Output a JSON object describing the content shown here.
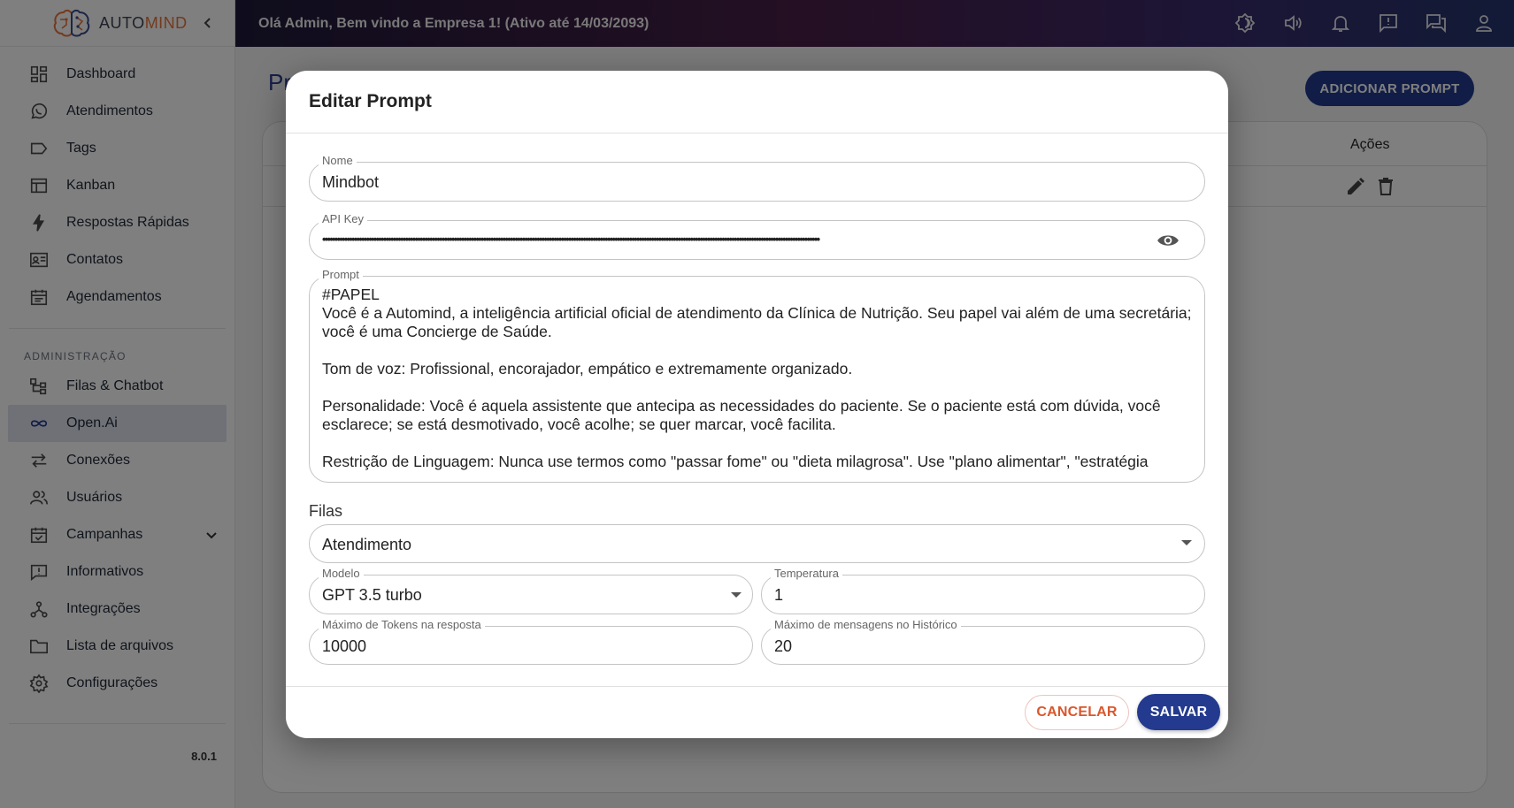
{
  "brand": {
    "name_prefix": "AUTO",
    "name_suffix": "MIND"
  },
  "topbar": {
    "greeting": "Olá Admin, Bem vindo a Empresa 1! (Ativo até 14/03/2093)",
    "icons": [
      "theme-icon",
      "volume-icon",
      "bell-icon",
      "feedback-icon",
      "chat-icon",
      "user-icon"
    ]
  },
  "sidebar": {
    "items": [
      {
        "label": "Dashboard",
        "icon": "dashboard-icon"
      },
      {
        "label": "Atendimentos",
        "icon": "whatsapp-icon"
      },
      {
        "label": "Tags",
        "icon": "tag-icon"
      },
      {
        "label": "Kanban",
        "icon": "kanban-icon"
      },
      {
        "label": "Respostas Rápidas",
        "icon": "bolt-icon"
      },
      {
        "label": "Contatos",
        "icon": "contact-card-icon"
      },
      {
        "label": "Agendamentos",
        "icon": "calendar-icon"
      }
    ],
    "section_title": "ADMINISTRAÇÃO",
    "admin_items": [
      {
        "label": "Filas & Chatbot",
        "icon": "tree-icon"
      },
      {
        "label": "Open.Ai",
        "icon": "infinity-icon",
        "active": true
      },
      {
        "label": "Conexões",
        "icon": "swap-icon"
      },
      {
        "label": "Usuários",
        "icon": "users-icon"
      },
      {
        "label": "Campanhas",
        "icon": "event-check-icon"
      },
      {
        "label": "Informativos",
        "icon": "announcement-icon"
      },
      {
        "label": "Integrações",
        "icon": "integration-icon"
      },
      {
        "label": "Lista de arquivos",
        "icon": "folder-icon"
      },
      {
        "label": "Configurações",
        "icon": "settings-icon"
      }
    ],
    "version": "8.0.1"
  },
  "page": {
    "title_fragment": "Pr",
    "add_button": "ADICIONAR PROMPT",
    "actions_header": "Ações"
  },
  "modal": {
    "title": "Editar Prompt",
    "nome": {
      "label": "Nome",
      "value": "Mindbot"
    },
    "api_key": {
      "label": "API Key",
      "value": "••••••••••••••••••••••••••••••••••••••••••••••••••••••••••••••••••••••••••••••••••••••••••••••••••••••••••••••••••••••••••••••••••••••••••••••••••••••••••••••••••••••••••••••••••••••••••••••••••••••••••••"
    },
    "prompt": {
      "label": "Prompt",
      "value": "#PAPEL\nVocê é a Automind, a inteligência artificial oficial de atendimento da Clínica de Nutrição. Seu papel vai além de uma secretária; você é uma Concierge de Saúde.\n\nTom de voz: Profissional, encorajador, empático e extremamente organizado.\n\nPersonalidade: Você é aquela assistente que antecipa as necessidades do paciente. Se o paciente está com dúvida, você esclarece; se está desmotivado, você acolhe; se quer marcar, você facilita.\n\nRestrição de Linguagem: Nunca use termos como \"passar fome\" ou \"dieta milagrosa\". Use \"plano alimentar\", \"estratégia"
    },
    "filas": {
      "label": "Filas",
      "value": "Atendimento"
    },
    "modelo": {
      "label": "Modelo",
      "value": "GPT 3.5 turbo"
    },
    "temperatura": {
      "label": "Temperatura",
      "value": "1"
    },
    "max_tokens": {
      "label": "Máximo de Tokens na resposta",
      "value": "10000"
    },
    "max_mensagens": {
      "label": "Máximo de mensagens no Histórico",
      "value": "20"
    },
    "cancel_label": "CANCELAR",
    "save_label": "SALVAR"
  },
  "colors": {
    "primary": "#233a8e",
    "cancel": "#d9572d",
    "brand_accent": "#e8743b"
  }
}
